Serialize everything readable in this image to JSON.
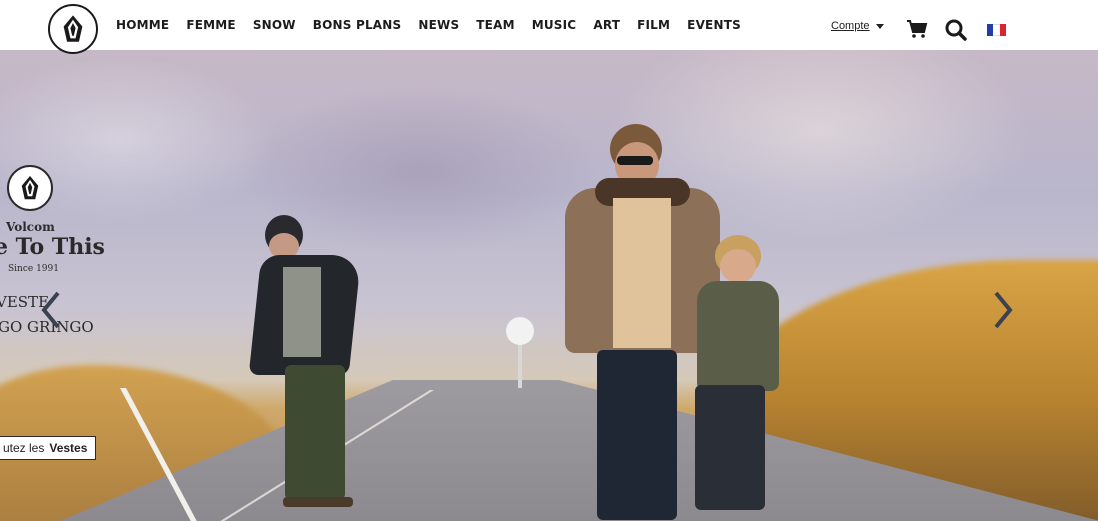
{
  "nav": {
    "items": [
      "Homme",
      "Femme",
      "Snow",
      "Bons Plans",
      "News",
      "Team",
      "Music",
      "Art",
      "Film",
      "Events"
    ]
  },
  "header": {
    "account_label": "Compte",
    "cart_icon": "cart-icon",
    "search_icon": "search-icon",
    "language_flag": "fr-flag-icon",
    "flag_colors": [
      "#1f3ea8",
      "#ffffff",
      "#d9252f"
    ]
  },
  "hero": {
    "brand_name": "Volcom",
    "brand_tagline": "e To This",
    "brand_since": "Since 1991",
    "promo_line1": "VESTE",
    "promo_line2": "GO GRINGO",
    "cta_prefix": "utez les",
    "cta_bold": "Vestes",
    "prev_icon": "chevron-left-icon",
    "next_icon": "chevron-right-icon"
  },
  "colors": {
    "text_dark": "#1c1c1c",
    "header_bg": "#ffffff"
  }
}
